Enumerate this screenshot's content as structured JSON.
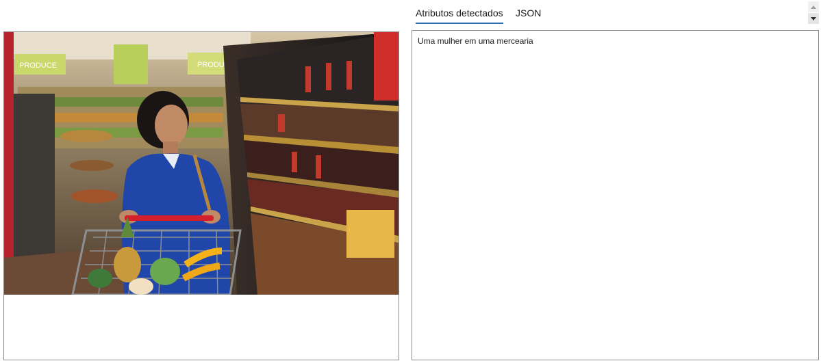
{
  "tabs": [
    {
      "label": "Atributos detectados",
      "active": true
    },
    {
      "label": "JSON",
      "active": false
    }
  ],
  "result": {
    "caption": "Uma mulher em uma mercearia"
  },
  "image": {
    "alt": "Uma mulher em uma mercearia",
    "store_signs": [
      "PRODUCE",
      "PRODUCE"
    ]
  },
  "colors": {
    "accent": "#2b6cb0",
    "border": "#8a8a8a"
  },
  "icons": {
    "scroll_up": "triangle-up-icon",
    "scroll_down": "triangle-down-icon"
  }
}
